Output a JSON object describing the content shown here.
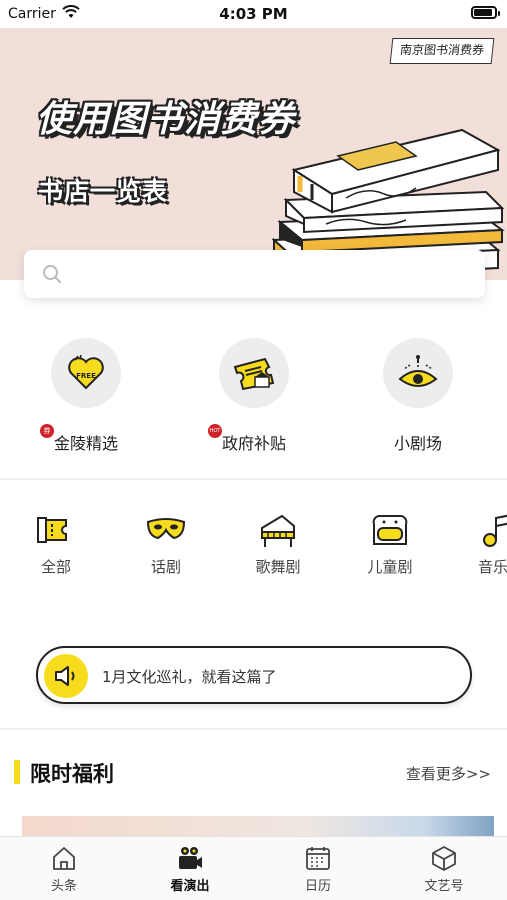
{
  "status_bar": {
    "carrier": "Carrier",
    "time": "4:03 PM"
  },
  "banner": {
    "tag": "南京图书消费券",
    "title": "使用图书消费券",
    "subtitle": "书店一览表"
  },
  "search": {
    "placeholder": ""
  },
  "features": [
    {
      "label": "金陵精选",
      "badge": "券",
      "icon": "heart-free-icon"
    },
    {
      "label": "政府补贴",
      "badge": "HOT",
      "icon": "ticket-icon"
    },
    {
      "label": "小剧场",
      "icon": "stage-eye-icon"
    }
  ],
  "categories": [
    {
      "label": "全部",
      "icon": "ticket-icon"
    },
    {
      "label": "话剧",
      "icon": "mask-icon"
    },
    {
      "label": "歌舞剧",
      "icon": "piano-icon"
    },
    {
      "label": "儿童剧",
      "icon": "toast-icon"
    },
    {
      "label": "音乐",
      "icon": "music-note-icon"
    }
  ],
  "notice": {
    "text": "1月文化巡礼，就看这篇了",
    "icon": "speaker-icon"
  },
  "section": {
    "title": "限时福利",
    "more": "查看更多>>"
  },
  "tabs": [
    {
      "label": "头条",
      "icon": "home-icon",
      "active": false
    },
    {
      "label": "看演出",
      "icon": "camera-icon",
      "active": true
    },
    {
      "label": "日历",
      "icon": "calendar-icon",
      "active": false
    },
    {
      "label": "文艺号",
      "icon": "cube-icon",
      "active": false
    }
  ],
  "colors": {
    "accent": "#f7dc1e",
    "banner_bg": "#f3dfda",
    "hot": "#d1232a"
  }
}
